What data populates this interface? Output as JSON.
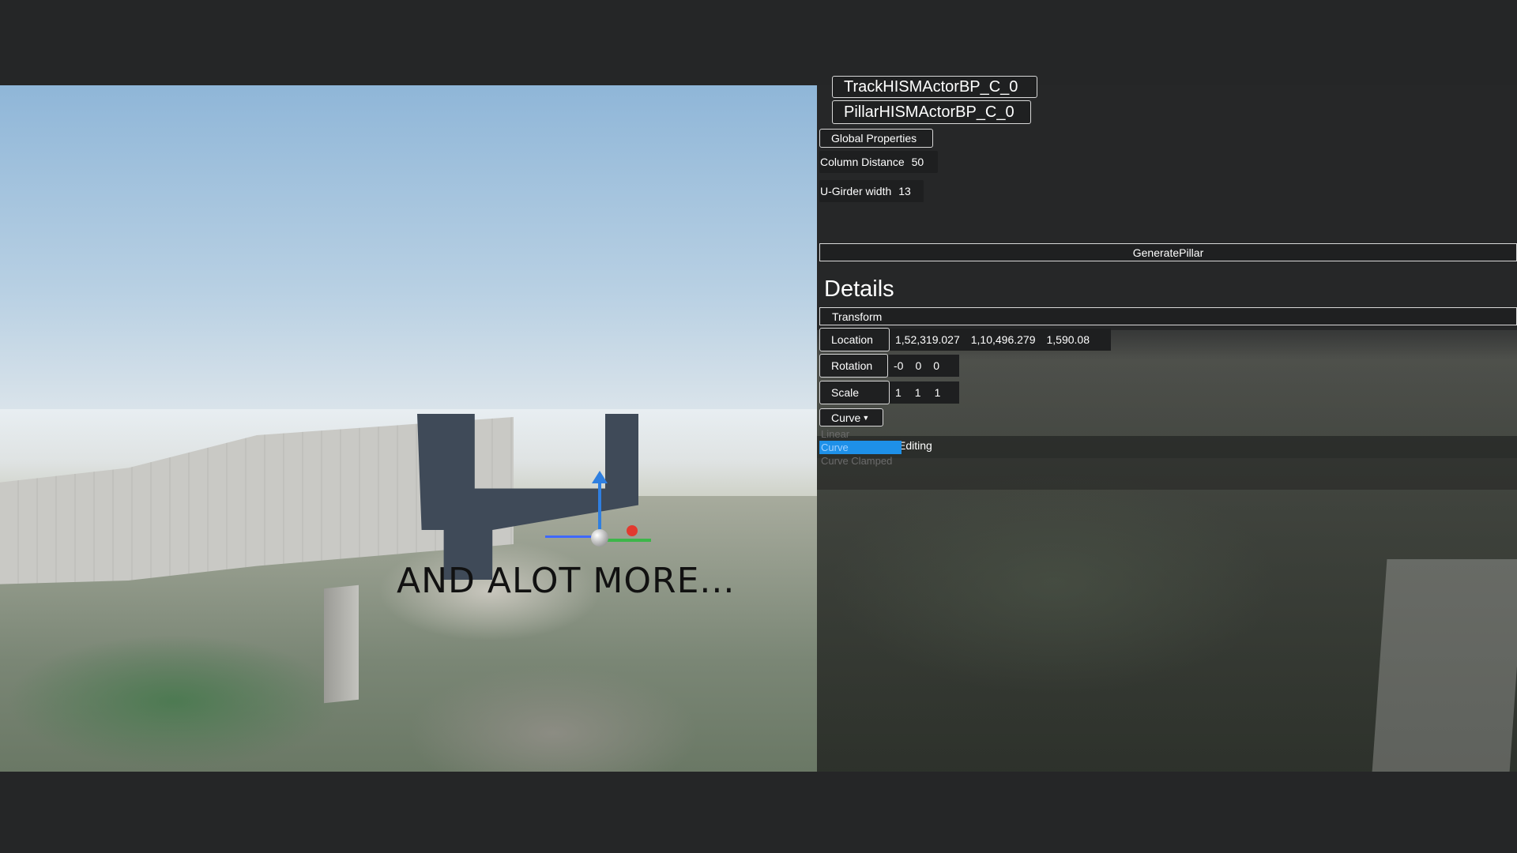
{
  "viewport": {
    "overlay_text": "AND ALOT MORE..."
  },
  "panel": {
    "actors": [
      {
        "label": "TrackHISMActorBP_C_0"
      },
      {
        "label": "PillarHISMActorBP_C_0"
      }
    ],
    "global_properties_label": "Global Properties",
    "column_distance": {
      "label": "Column Distance",
      "value": "50"
    },
    "u_girder_width": {
      "label": "U-Girder width",
      "value": "13"
    },
    "generate_pillar_label": "GeneratePillar",
    "details_title": "Details",
    "transform_label": "Transform",
    "location": {
      "label": "Location",
      "x": "1,52,319.027",
      "y": "1,10,496.279",
      "z": "1,590.08"
    },
    "rotation": {
      "label": "Rotation",
      "x": "-0",
      "y": "0",
      "z": "0"
    },
    "scale": {
      "label": "Scale",
      "x": "1",
      "y": "1",
      "z": "1"
    },
    "curve_dropdown": {
      "label": "Curve",
      "options": [
        "Linear",
        "Curve",
        "Curve Clamped"
      ],
      "selected": "Curve"
    },
    "editing_text": "Editing"
  },
  "colors": {
    "background": "#252627",
    "panel": "#262728",
    "selection": "#1e90e8"
  }
}
